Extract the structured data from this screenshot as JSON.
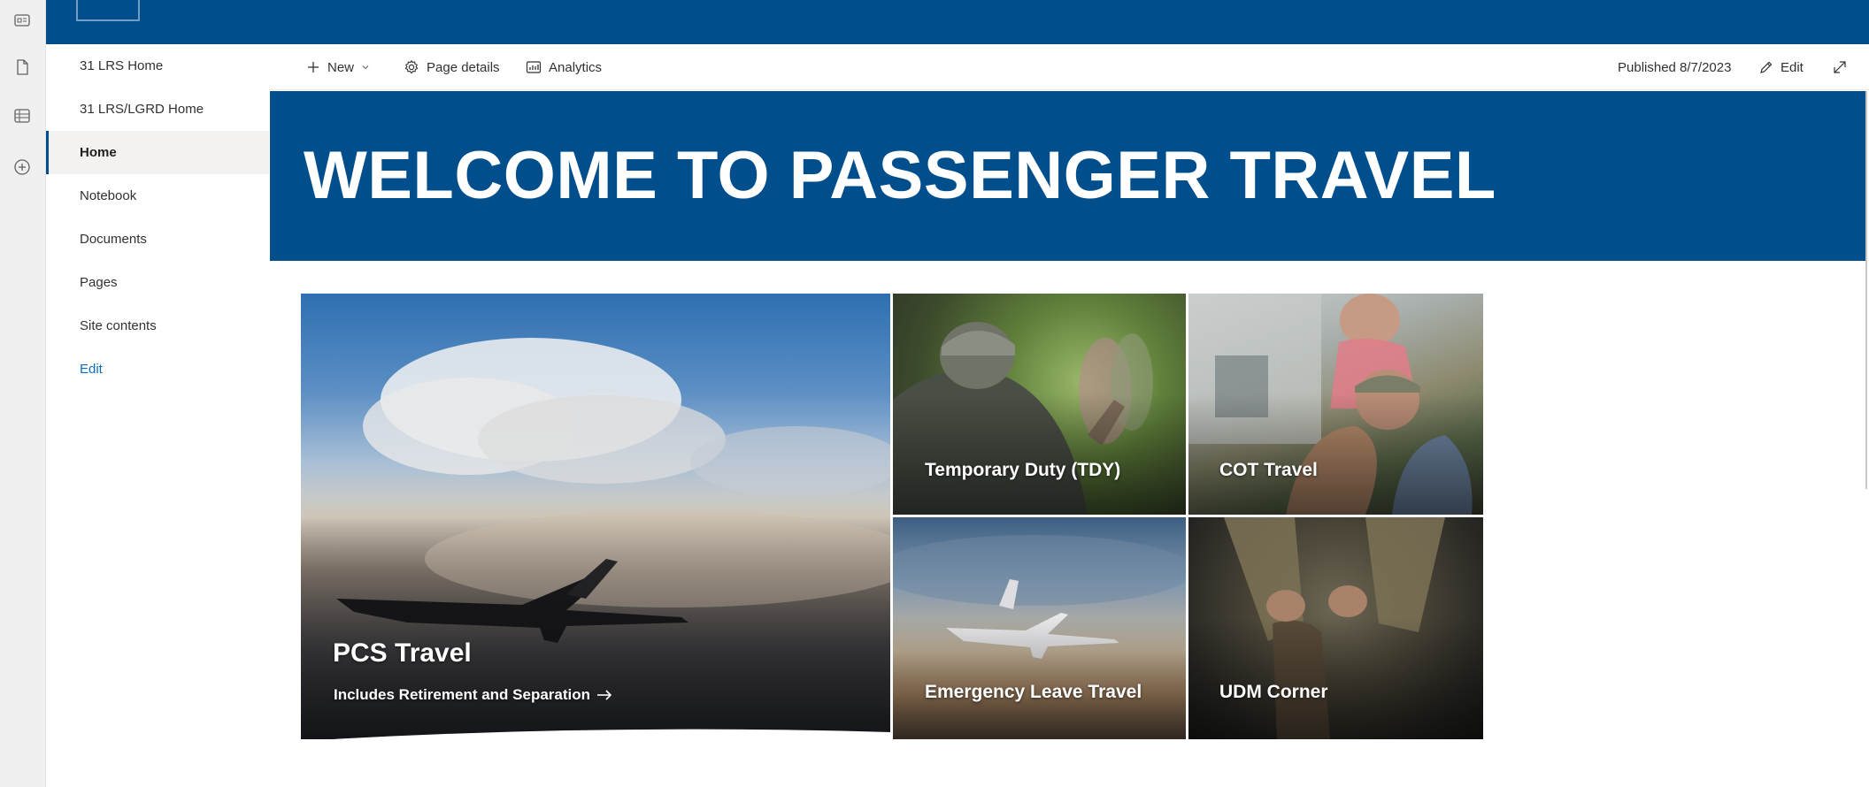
{
  "app_rail": {
    "icons": [
      "news-icon",
      "document-icon",
      "list-icon",
      "add-icon"
    ]
  },
  "suite_bar": {
    "color": "#004e8c"
  },
  "left_nav": {
    "items": [
      {
        "label": "31 LRS Home"
      },
      {
        "label": "31 LRS/LGRD Home"
      },
      {
        "label": "Home"
      },
      {
        "label": "Notebook"
      },
      {
        "label": "Documents"
      },
      {
        "label": "Pages"
      },
      {
        "label": "Site contents"
      },
      {
        "label": "Edit"
      }
    ],
    "selected": "Home"
  },
  "command_bar": {
    "new_label": "New",
    "page_details_label": "Page details",
    "analytics_label": "Analytics",
    "published_label": "Published 8/7/2023",
    "edit_label": "Edit"
  },
  "hero": {
    "title": "WELCOME TO PASSENGER TRAVEL",
    "background": "#004e8c"
  },
  "tiles": {
    "pcs": {
      "title": "PCS Travel",
      "subtitle": "Includes Retirement and Separation"
    },
    "tdy": {
      "title": "Temporary Duty (TDY)"
    },
    "cot": {
      "title": "COT Travel"
    },
    "emergency": {
      "title": "Emergency Leave Travel"
    },
    "udm": {
      "title": "UDM Corner"
    }
  }
}
